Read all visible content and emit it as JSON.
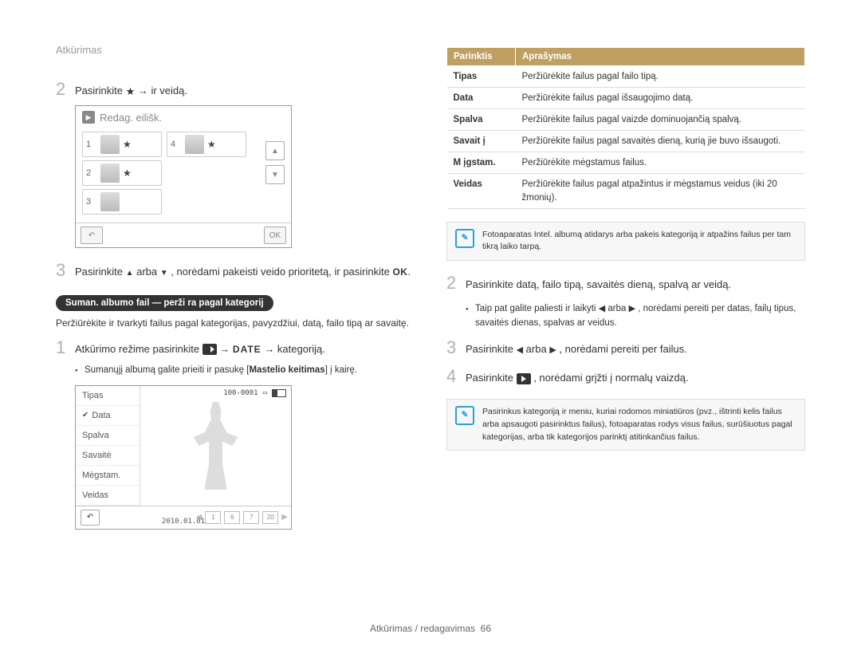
{
  "breadcrumb": "Atkūrimas",
  "left": {
    "step2": {
      "pre": "Pasirinkite ",
      "post": " → ir veidą."
    },
    "screen1_title": "Redag. eilišk.",
    "faces": {
      "n1": "1",
      "n2": "2",
      "n3": "3",
      "n4": "4"
    },
    "ok_label": "OK",
    "step3": {
      "pre": "Pasirinkite ",
      "mid": " arba ",
      "post1": ", norėdami pakeisti veido prioritetą, ir pasirinkite ",
      "ok": "OK",
      "end": "."
    },
    "pill": "Suman. albumo fail — perži ra pagal kategorij",
    "para1": "Peržiūrėkite ir tvarkyti failus pagal kategorijas, pavyzdžiui, datą, failo tipą ar savaitę.",
    "step1b": {
      "pre": "Atkūrimo režime pasirinkite ",
      "date": "DATE",
      "post": " → kategoriją."
    },
    "bullet1": {
      "pre": "Sumanųjį albumą galite prieiti ir pasukę [",
      "bold": "Mastelio keitimas",
      "post": "] į kairę."
    },
    "screen2": {
      "items": [
        "Tipas",
        "Data",
        "Spalva",
        "Savaitė",
        "Mėgstam.",
        "Veidas"
      ],
      "selected_index": 1,
      "counter": "100-0001",
      "film": [
        "1",
        "6",
        "7",
        "20"
      ],
      "date": "2010.01.01"
    }
  },
  "right": {
    "table": {
      "h1": "Parinktis",
      "h2": "Aprašymas",
      "rows": [
        {
          "k": "Tipas",
          "v": "Peržiūrėkite failus pagal failo tipą."
        },
        {
          "k": "Data",
          "v": "Peržiūrėkite failus pagal išsaugojimo datą."
        },
        {
          "k": "Spalva",
          "v": "Peržiūrėkite failus pagal vaizde dominuojančią spalvą."
        },
        {
          "k": "Savait į",
          "v": "Peržiūrėkite failus pagal savaitės dieną, kurią jie buvo išsaugoti."
        },
        {
          "k": "M įgstam.",
          "v": "Peržiūrėkite mėgstamus failus."
        },
        {
          "k": "Veidas",
          "v": "Peržiūrėkite failus pagal atpažintus ir mėgstamus veidus (iki 20 žmonių)."
        }
      ]
    },
    "note1": "Fotoaparatas Intel. albumą atidarys arba pakeis kategoriją ir atpažins failus per tam tikrą laiko tarpą.",
    "step2r": "Pasirinkite datą, failo tipą, savaitės dieną, spalvą ar veidą.",
    "bullet2": {
      "pre": "Taip pat galite paliesti ir laikyti ",
      "mid": " arba ",
      "post": ", norėdami pereiti per datas, failų tipus, savaitės dienas, spalvas ar veidus."
    },
    "step3r": {
      "pre": "Pasirinkite ",
      "mid": " arba ",
      "post": ", norėdami pereiti per failus."
    },
    "step4r": {
      "pre": "Pasirinkite ",
      "post": ", norėdami grįžti į normalų vaizdą."
    },
    "note2": "Pasirinkus kategoriją ir meniu, kuriai rodomos miniatiūros (pvz., ištrinti kelis failus arba apsaugoti pasirinktus failus), fotoaparatas rodys visus failus, surūšiuotus pagal kategorijas, arba tik kategorijos parinktį atitinkančius failus."
  },
  "footer": {
    "text": "Atkūrimas / redagavimas",
    "page": "66"
  }
}
